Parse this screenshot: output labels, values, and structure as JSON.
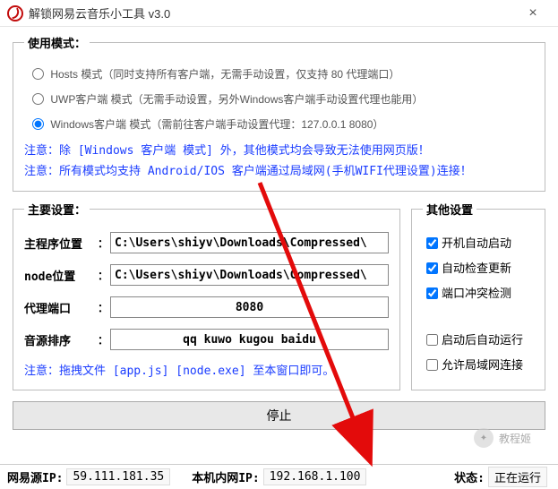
{
  "window": {
    "title": "解锁网易云音乐小工具 v3.0",
    "close_glyph": "×"
  },
  "mode": {
    "legend": "使用模式：",
    "hosts": "Hosts 模式（同时支持所有客户端，无需手动设置，仅支持 80 代理端口）",
    "uwp": "UWP客户端 模式（无需手动设置，另外Windows客户端手动设置代理也能用）",
    "win": "Windows客户端 模式（需前往客户端手动设置代理：127.0.0.1 8080）",
    "note1": "注意：除 [Windows 客户端 模式] 外，其他模式均会导致无法使用网页版！",
    "note2": "注意：所有模式均支持 Android/IOS 客户端通过局域网(手机WIFI代理设置)连接！"
  },
  "main": {
    "legend": "主要设置：",
    "path_label": "主程序位置",
    "path_value": "C:\\Users\\shiyv\\Downloads\\Compressed\\",
    "node_label": "node位置",
    "node_value": "C:\\Users\\shiyv\\Downloads\\Compressed\\",
    "port_label": "代理端口",
    "port_value": "8080",
    "order_label": "音源排序",
    "order_value": "qq kuwo kugou baidu",
    "note": "注意：拖拽文件 [app.js] [node.exe] 至本窗口即可。",
    "colon": "："
  },
  "other": {
    "legend": "其他设置",
    "autostart": "开机自动启动",
    "autocheck": "自动检查更新",
    "portcheck": "端口冲突检测",
    "autorun": "启动后自动运行",
    "lan": "允许局域网连接"
  },
  "button": {
    "stop": "停止"
  },
  "status": {
    "src_label": "网易源IP:",
    "src_value": "59.111.181.35",
    "local_label": "本机内网IP:",
    "local_value": "192.168.1.100",
    "state_label": "状态:",
    "state_value": "正在运行"
  },
  "watermark": {
    "text": "教程姬"
  }
}
